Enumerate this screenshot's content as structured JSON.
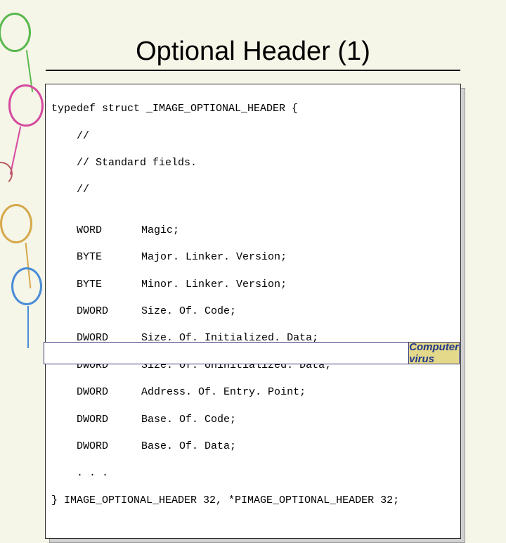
{
  "title": "Optional Header (1)",
  "code": {
    "decl_open": "typedef struct _IMAGE_OPTIONAL_HEADER {",
    "comment_lines": [
      "    //",
      "    // Standard fields.",
      "    //"
    ],
    "blank": "",
    "fields": [
      {
        "type": "WORD",
        "name": "Magic;"
      },
      {
        "type": "BYTE",
        "name": "Major. Linker. Version;"
      },
      {
        "type": "BYTE",
        "name": "Minor. Linker. Version;"
      },
      {
        "type": "DWORD",
        "name": "Size. Of. Code;"
      },
      {
        "type": "DWORD",
        "name": "Size. Of. Initialized. Data;"
      },
      {
        "type": "DWORD",
        "name": "Size. Of. Uninitialized. Data;"
      },
      {
        "type": "DWORD",
        "name": "Address. Of. Entry. Point;"
      },
      {
        "type": "DWORD",
        "name": "Base. Of. Code;"
      },
      {
        "type": "DWORD",
        "name": "Base. Of. Data;"
      }
    ],
    "ellipsis": "    . . .",
    "decl_close": "} IMAGE_OPTIONAL_HEADER 32, *PIMAGE_OPTIONAL_HEADER 32;"
  },
  "footer": {
    "label": "Computer virus"
  }
}
